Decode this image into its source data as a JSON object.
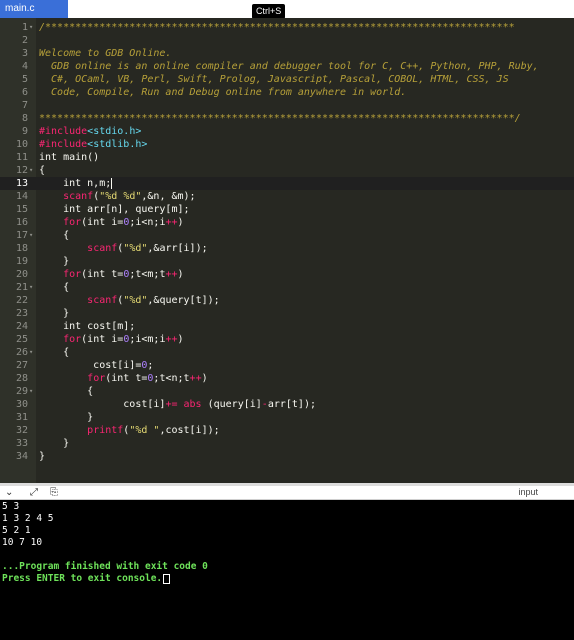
{
  "tab": {
    "label": "main.c"
  },
  "tooltip": {
    "label": "Ctrl+S"
  },
  "editor": {
    "active_line": 13,
    "lines": [
      {
        "n": "1",
        "fold": true,
        "tokens": [
          {
            "t": "/******************************************************************************",
            "c": "c-com"
          }
        ]
      },
      {
        "n": "2",
        "fold": false,
        "tokens": []
      },
      {
        "n": "3",
        "fold": false,
        "tokens": [
          {
            "t": "Welcome to GDB Online.",
            "c": "c-com"
          }
        ]
      },
      {
        "n": "4",
        "fold": false,
        "tokens": [
          {
            "t": "  GDB online is an online compiler and debugger tool for C, C++, Python, PHP, Ruby,",
            "c": "c-com"
          }
        ]
      },
      {
        "n": "5",
        "fold": false,
        "tokens": [
          {
            "t": "  C#, OCaml, VB, Perl, Swift, Prolog, Javascript, Pascal, COBOL, HTML, CSS, JS",
            "c": "c-com"
          }
        ]
      },
      {
        "n": "6",
        "fold": false,
        "tokens": [
          {
            "t": "  Code, Compile, Run and Debug online from anywhere in world.",
            "c": "c-com"
          }
        ]
      },
      {
        "n": "7",
        "fold": false,
        "tokens": []
      },
      {
        "n": "8",
        "fold": false,
        "tokens": [
          {
            "t": "*******************************************************************************/",
            "c": "c-com"
          }
        ]
      },
      {
        "n": "9",
        "fold": false,
        "tokens": [
          {
            "t": "#include",
            "c": "c-pre"
          },
          {
            "t": "<stdio.h>",
            "c": "c-inc"
          }
        ]
      },
      {
        "n": "10",
        "fold": false,
        "tokens": [
          {
            "t": "#include",
            "c": "c-pre"
          },
          {
            "t": "<stdlib.h>",
            "c": "c-inc"
          }
        ]
      },
      {
        "n": "11",
        "fold": false,
        "tokens": [
          {
            "t": "int main()",
            "c": ""
          }
        ]
      },
      {
        "n": "12",
        "fold": true,
        "tokens": [
          {
            "t": "{",
            "c": ""
          }
        ]
      },
      {
        "n": "13",
        "fold": false,
        "tokens": [
          {
            "t": "    int n,m;",
            "c": ""
          }
        ],
        "cursor": true
      },
      {
        "n": "14",
        "fold": false,
        "tokens": [
          {
            "t": "    ",
            "c": ""
          },
          {
            "t": "scanf",
            "c": "c-fn"
          },
          {
            "t": "(",
            "c": ""
          },
          {
            "t": "\"%d %d\"",
            "c": "c-str"
          },
          {
            "t": ",&n, &m);",
            "c": ""
          }
        ]
      },
      {
        "n": "15",
        "fold": false,
        "tokens": [
          {
            "t": "    int arr[n], query[m];",
            "c": ""
          }
        ]
      },
      {
        "n": "16",
        "fold": false,
        "tokens": [
          {
            "t": "    ",
            "c": ""
          },
          {
            "t": "for",
            "c": "c-kw"
          },
          {
            "t": "(int i=",
            "c": ""
          },
          {
            "t": "0",
            "c": "c-num"
          },
          {
            "t": ";i<n;i",
            "c": ""
          },
          {
            "t": "++",
            "c": "c-kw"
          },
          {
            "t": ")",
            "c": ""
          }
        ]
      },
      {
        "n": "17",
        "fold": true,
        "tokens": [
          {
            "t": "    {",
            "c": ""
          }
        ]
      },
      {
        "n": "18",
        "fold": false,
        "tokens": [
          {
            "t": "        ",
            "c": ""
          },
          {
            "t": "scanf",
            "c": "c-fn"
          },
          {
            "t": "(",
            "c": ""
          },
          {
            "t": "\"%d\"",
            "c": "c-str"
          },
          {
            "t": ",&arr[i]);",
            "c": ""
          }
        ]
      },
      {
        "n": "19",
        "fold": false,
        "tokens": [
          {
            "t": "    }",
            "c": ""
          }
        ]
      },
      {
        "n": "20",
        "fold": false,
        "tokens": [
          {
            "t": "    ",
            "c": ""
          },
          {
            "t": "for",
            "c": "c-kw"
          },
          {
            "t": "(int t=",
            "c": ""
          },
          {
            "t": "0",
            "c": "c-num"
          },
          {
            "t": ";t<m;t",
            "c": ""
          },
          {
            "t": "++",
            "c": "c-kw"
          },
          {
            "t": ")",
            "c": ""
          }
        ]
      },
      {
        "n": "21",
        "fold": true,
        "tokens": [
          {
            "t": "    {",
            "c": ""
          }
        ]
      },
      {
        "n": "22",
        "fold": false,
        "tokens": [
          {
            "t": "        ",
            "c": ""
          },
          {
            "t": "scanf",
            "c": "c-fn"
          },
          {
            "t": "(",
            "c": ""
          },
          {
            "t": "\"%d\"",
            "c": "c-str"
          },
          {
            "t": ",&query[t]);",
            "c": ""
          }
        ]
      },
      {
        "n": "23",
        "fold": false,
        "tokens": [
          {
            "t": "    }",
            "c": ""
          }
        ]
      },
      {
        "n": "24",
        "fold": false,
        "tokens": [
          {
            "t": "    int cost[m];",
            "c": ""
          }
        ]
      },
      {
        "n": "25",
        "fold": false,
        "tokens": [
          {
            "t": "    ",
            "c": ""
          },
          {
            "t": "for",
            "c": "c-kw"
          },
          {
            "t": "(int i=",
            "c": ""
          },
          {
            "t": "0",
            "c": "c-num"
          },
          {
            "t": ";i<m;i",
            "c": ""
          },
          {
            "t": "++",
            "c": "c-kw"
          },
          {
            "t": ")",
            "c": ""
          }
        ]
      },
      {
        "n": "26",
        "fold": true,
        "tokens": [
          {
            "t": "    {",
            "c": ""
          }
        ]
      },
      {
        "n": "27",
        "fold": false,
        "tokens": [
          {
            "t": "         cost[i]=",
            "c": ""
          },
          {
            "t": "0",
            "c": "c-num"
          },
          {
            "t": ";",
            "c": ""
          }
        ]
      },
      {
        "n": "28",
        "fold": false,
        "tokens": [
          {
            "t": "        ",
            "c": ""
          },
          {
            "t": "for",
            "c": "c-kw"
          },
          {
            "t": "(int t=",
            "c": ""
          },
          {
            "t": "0",
            "c": "c-num"
          },
          {
            "t": ";t<n;t",
            "c": ""
          },
          {
            "t": "++",
            "c": "c-kw"
          },
          {
            "t": ")",
            "c": ""
          }
        ]
      },
      {
        "n": "29",
        "fold": true,
        "tokens": [
          {
            "t": "        {",
            "c": ""
          }
        ]
      },
      {
        "n": "30",
        "fold": false,
        "tokens": [
          {
            "t": "              cost[i]",
            "c": ""
          },
          {
            "t": "+=",
            "c": "c-kw"
          },
          {
            "t": " ",
            "c": ""
          },
          {
            "t": "abs",
            "c": "c-fn"
          },
          {
            "t": " (query[i]",
            "c": ""
          },
          {
            "t": "-",
            "c": "c-kw"
          },
          {
            "t": "arr[t]);",
            "c": ""
          }
        ]
      },
      {
        "n": "31",
        "fold": false,
        "tokens": [
          {
            "t": "        }",
            "c": ""
          }
        ]
      },
      {
        "n": "32",
        "fold": false,
        "tokens": [
          {
            "t": "        ",
            "c": ""
          },
          {
            "t": "printf",
            "c": "c-fn"
          },
          {
            "t": "(",
            "c": ""
          },
          {
            "t": "\"%d \"",
            "c": "c-str"
          },
          {
            "t": ",cost[i]);",
            "c": ""
          }
        ]
      },
      {
        "n": "33",
        "fold": false,
        "tokens": [
          {
            "t": "    }",
            "c": ""
          }
        ]
      },
      {
        "n": "34",
        "fold": false,
        "tokens": [
          {
            "t": "}",
            "c": ""
          }
        ]
      }
    ]
  },
  "console_toolbar": {
    "icons": [
      "chevron-down-icon",
      "expand-icon",
      "copy-icon"
    ],
    "input_label": "input"
  },
  "console": {
    "lines": [
      {
        "text": "5 3",
        "style": "c-white"
      },
      {
        "text": "1 3 2 4 5",
        "style": "c-white"
      },
      {
        "text": "5 2 1",
        "style": "c-white"
      },
      {
        "text": "10 7 10",
        "style": "c-white"
      },
      {
        "text": "",
        "style": "c-white"
      },
      {
        "text": "...Program finished with exit code 0",
        "style": "c-green"
      },
      {
        "text": "Press ENTER to exit console.",
        "style": "c-green",
        "cursor": true
      }
    ]
  }
}
